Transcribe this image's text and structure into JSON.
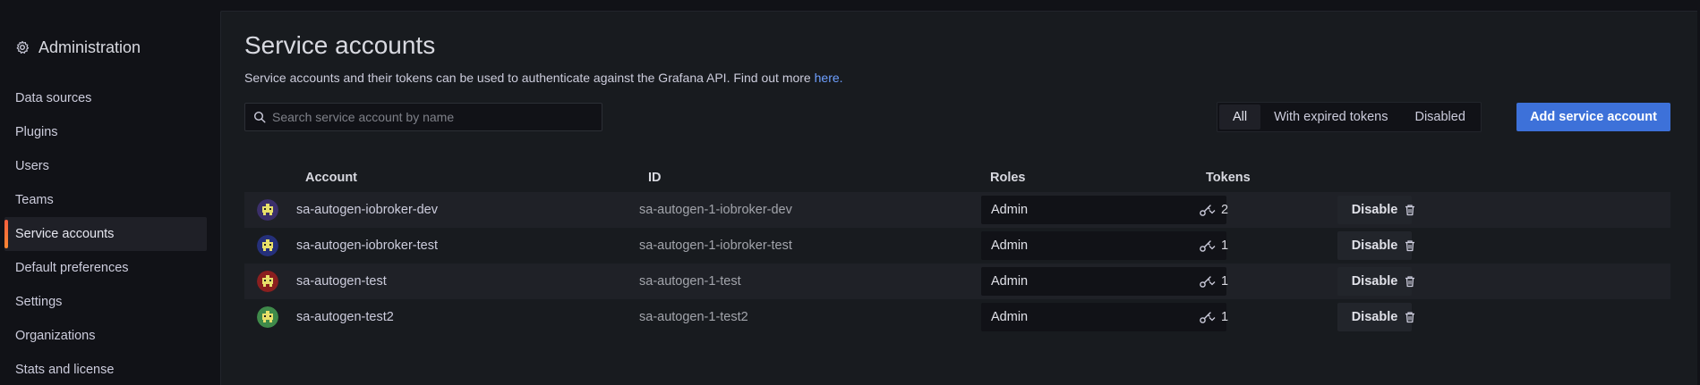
{
  "sidebar": {
    "title": "Administration",
    "header_icon": "gear-icon",
    "items": [
      {
        "label": "Data sources"
      },
      {
        "label": "Plugins"
      },
      {
        "label": "Users"
      },
      {
        "label": "Teams"
      },
      {
        "label": "Service accounts",
        "active": true
      },
      {
        "label": "Default preferences"
      },
      {
        "label": "Settings"
      },
      {
        "label": "Organizations"
      },
      {
        "label": "Stats and license"
      }
    ]
  },
  "page": {
    "title": "Service accounts",
    "subtitle": "Service accounts and their tokens can be used to authenticate against the Grafana API. Find out more ",
    "subtitle_link": "here."
  },
  "search": {
    "placeholder": "Search service account by name",
    "value": ""
  },
  "filters": {
    "all": "All",
    "expired": "With expired tokens",
    "disabled": "Disabled",
    "selected": "All"
  },
  "actions": {
    "add_label": "Add service account"
  },
  "table": {
    "headers": {
      "account": "Account",
      "id": "ID",
      "roles": "Roles",
      "tokens": "Tokens"
    },
    "rows": [
      {
        "account": "sa-autogen-iobroker-dev",
        "id": "sa-autogen-1-iobroker-dev",
        "role": "Admin",
        "tokens": "2",
        "disable_label": "Disable",
        "avatar_color": "#3b2f6a"
      },
      {
        "account": "sa-autogen-iobroker-test",
        "id": "sa-autogen-1-iobroker-test",
        "role": "Admin",
        "tokens": "1",
        "disable_label": "Disable",
        "avatar_color": "#25307a"
      },
      {
        "account": "sa-autogen-test",
        "id": "sa-autogen-1-test",
        "role": "Admin",
        "tokens": "1",
        "disable_label": "Disable",
        "avatar_color": "#8a1f1f"
      },
      {
        "account": "sa-autogen-test2",
        "id": "sa-autogen-1-test2",
        "role": "Admin",
        "tokens": "1",
        "disable_label": "Disable",
        "avatar_color": "#3f8a4a"
      }
    ]
  },
  "colors": {
    "primary": "#3d71d9",
    "link": "#6e9fff",
    "active_accent": "#f55f3e"
  }
}
